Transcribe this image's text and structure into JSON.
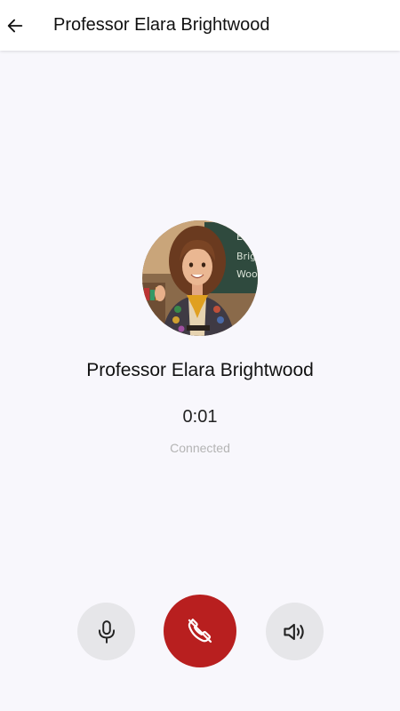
{
  "header": {
    "title": "Professor Elara Brightwood",
    "back_icon": "arrow-left-icon"
  },
  "call": {
    "caller_name": "Professor Elara Brightwood",
    "duration": "0:01",
    "status": "Connected",
    "avatar": "caller-avatar-image",
    "board_text": [
      "Ela",
      "Brig",
      "Woo"
    ]
  },
  "controls": {
    "mute_icon": "microphone-icon",
    "end_icon": "phone-hangup-icon",
    "speaker_icon": "speaker-icon"
  },
  "colors": {
    "end_call": "#b81f1f",
    "control_bg": "#e6e6e9",
    "background": "#f8f7fc",
    "status_text": "#b4b4b4"
  }
}
